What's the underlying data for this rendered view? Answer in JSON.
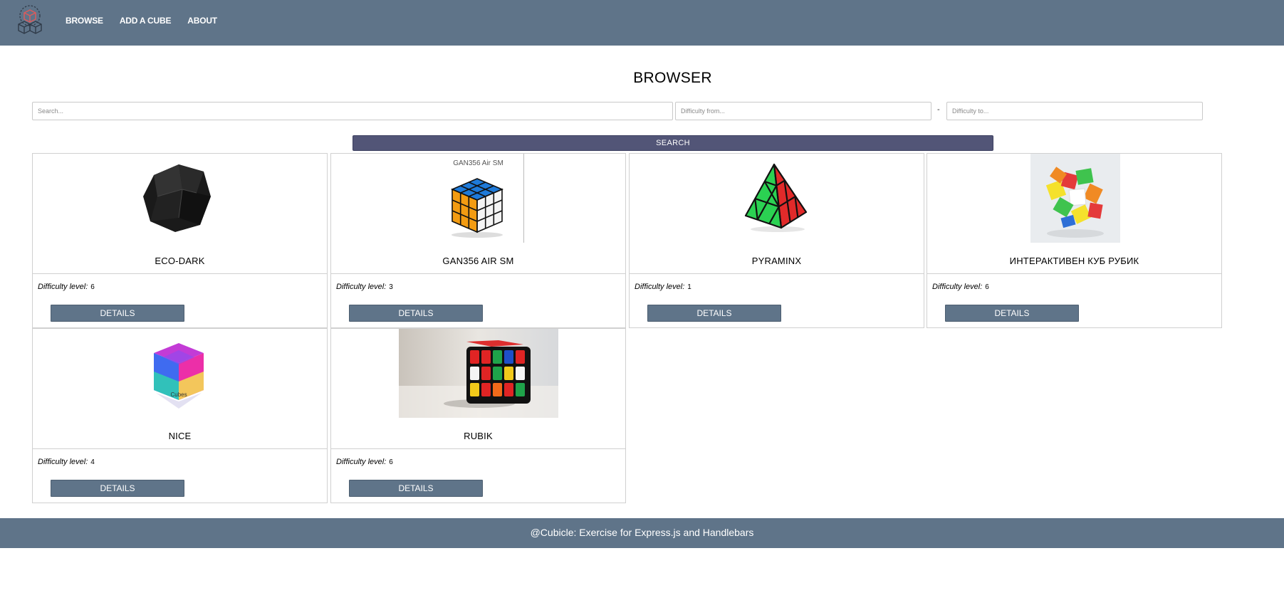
{
  "nav": {
    "items": [
      "BROWSE",
      "ADD A CUBE",
      "ABOUT"
    ],
    "logo": "cubes-logo-icon"
  },
  "page": {
    "title": "BROWSER"
  },
  "search": {
    "query_placeholder": "Search...",
    "from_placeholder": "Difficulty from...",
    "separator": "-",
    "to_placeholder": "Difficulty to...",
    "button_label": "SEARCH"
  },
  "cards": [
    {
      "name": "ECO-DARK",
      "difficulty_label": "Difficulty level:",
      "difficulty": "6",
      "details_label": "DETAILS",
      "image": "black-ghost-cube-image"
    },
    {
      "name": "GAN356 AIR SM",
      "difficulty_label": "Difficulty level:",
      "difficulty": "3",
      "details_label": "DETAILS",
      "image": "gan-speed-cube-image",
      "image_caption": "GAN356 Air SM"
    },
    {
      "name": "PYRAMINX",
      "difficulty_label": "Difficulty level:",
      "difficulty": "1",
      "details_label": "DETAILS",
      "image": "pyraminx-image"
    },
    {
      "name": "ИНТЕРАКТИВЕН КУБ РУБИК",
      "difficulty_label": "Difficulty level:",
      "difficulty": "6",
      "details_label": "DETAILS",
      "image": "twisted-puzzle-image"
    },
    {
      "name": "NICE",
      "difficulty_label": "Difficulty level:",
      "difficulty": "4",
      "details_label": "DETAILS",
      "image": "rainbow-crystal-cube-image",
      "image_caption": "Cubes"
    },
    {
      "name": "RUBIK",
      "difficulty_label": "Difficulty level:",
      "difficulty": "6",
      "details_label": "DETAILS",
      "image": "rubik-cube-photo-image"
    }
  ],
  "footer": {
    "text": "@Cubicle: Exercise for Express.js and Handlebars"
  },
  "colors": {
    "header": "#5f7489",
    "search_button": "#525577",
    "details_button": "#5f7489"
  }
}
